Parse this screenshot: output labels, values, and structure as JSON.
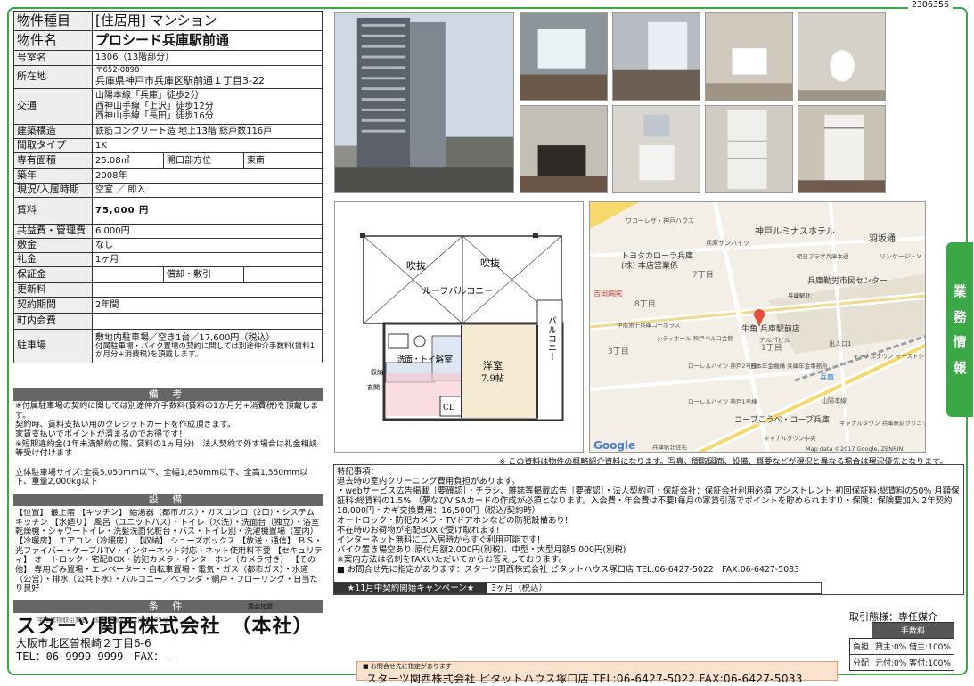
{
  "ref_no": "2306356",
  "property": {
    "rows": [
      {
        "key": "物件種目",
        "value": "[住居用] マンション"
      },
      {
        "key": "物件名",
        "value": "プロシード兵庫駅前通"
      },
      {
        "key": "号室名",
        "value": "1306（13階部分）"
      },
      {
        "key": "所在地",
        "postal": "〒652-0898",
        "value": "兵庫県神戸市兵庫区駅前通１丁目3-22"
      },
      {
        "key": "交通",
        "lines": [
          "山陽本線「兵庫」徒歩2分",
          "西神山手線「上沢」徒歩12分",
          "西神山手線「長田」徒歩16分"
        ]
      },
      {
        "key": "建築構造",
        "value": "鉄筋コンクリート造 地上13階 総戸数116戸"
      },
      {
        "key": "間取タイプ",
        "value": "1K"
      },
      {
        "key": "専有面積",
        "value": "25.08㎡",
        "key2": "開口部方位",
        "value2": "東南"
      },
      {
        "key": "築年",
        "value": "2008年"
      },
      {
        "key": "現況/入居時期",
        "value": "空室 ／ 即入"
      },
      {
        "key": "賃料",
        "value": "75,000 円"
      },
      {
        "key": "共益費・管理費",
        "value": "6,000円"
      },
      {
        "key": "敷金",
        "value": "なし"
      },
      {
        "key": "礼金",
        "value": "1ヶ月"
      },
      {
        "key": "保証金",
        "value": "",
        "key2": "償却・敷引",
        "value2": ""
      },
      {
        "key": "更新料",
        "value": ""
      },
      {
        "key": "契約期間",
        "value": "2年間"
      },
      {
        "key": "町内会費",
        "value": ""
      },
      {
        "key": "駐車場",
        "value": "敷地内駐車場／空き1台／17,600円（税込）",
        "note": "付属駐車場・バイク置場の契約に関しては別途仲介手数料(賃料1か月分+消費税)を頂戴します。"
      }
    ]
  },
  "bikou": {
    "title": "備 考",
    "text": "※付属駐車場の契約に関しては別途仲介手数料(賃料の1か月分+消費税)を頂戴します。\n契約時、賃料支払い用のクレジットカードを作成頂きます。\n家賃支払いでポイントが溜まるのでお得です！\n※短期違約金(1年未満解約の際、賃料の1ヵ月分)　法人契約で外す場合は礼金相談等受け付けます\n\n立体駐車場サイズ:全長5,050mm以下、全幅1,850mm以下、全高1,550mm以下、重量2,000kg以下"
  },
  "setsubi": {
    "title": "設 備",
    "text": "【位置】 最上階 【キッチン】 給湯器（都市ガス）・ガスコンロ（2口）・システムキッチン 【水廻り】 風呂（ユニットバス）・トイレ（水洗）・洗面台（独立）・浴室乾燥機・シャワートイレ・洗髪洗面化粧台・バス・トイレ別・洗濯機置場（室内） 【冷暖房】 エアコン（冷暖房） 【収納】 シューズボックス 【放送・通信】 ＢＳ・光ファイバー・ケーブルTV・インターネット対応・ネット使用料不要 【セキュリティ】 オートロック・宅配BOX・防犯カメラ・インターホン（カメラ付き） 【その他】 専用ごみ置場・エレベーター・自転車置場・電気・ガス（都市ガス）・水道（公営）・排水（公共下水）・バルコニー／ベランダ・網戸・フローリング・日当たり良好"
  },
  "jouken": {
    "title": "条 件"
  },
  "floorplan": {
    "labels": {
      "fukinuke1": "吹抜",
      "fukinuke2": "吹抜",
      "roof_balcony": "ルーフバルコニー",
      "balcony": "バルコニー",
      "washroom": "洗面・トイレ",
      "bath": "浴室",
      "room": "洋室",
      "room_size": "7.9帖",
      "storage": "収納",
      "entrance": "玄関",
      "closet": "CL"
    }
  },
  "map": {
    "labels": [
      "ワコーレザ・神戸ハウス",
      "神戸ルミナスホテル",
      "羽坂通",
      "兵庫サンハイツ",
      "トヨタカローラ兵庫",
      "(株) 本店営業係",
      "朝日プラザ兵庫本通",
      "リンケージ・V",
      "7丁目",
      "兵庫勤労市民センター",
      "吉田病院",
      "8丁目",
      "兵庫駅北",
      "甲南第十兵庫コーポラス",
      "牛角 兵庫駅前店",
      "シティホール 神戸ベルコ会館",
      "アルパビル",
      "3丁目",
      "1丁目",
      "出入口1",
      "ローレルハイツ 神戸2号棟",
      "日本年金機構 兵庫年金事務所",
      "兵庫",
      "キャナルタウン イーストシティハイツ",
      "ローレルハイツ 神戸1号棟",
      "山陽本線",
      "コープこうべ・コープ兵庫",
      "キャナルタウン 兵庫駅前クリニックビル",
      "キャナルタウン中央",
      "兵庫駅北住宅"
    ],
    "google": "Google",
    "attribution": "Map data ©2017 Google, ZENRIN"
  },
  "disclaimer": "※ この資料は物件の概略紹介資料になります。写真、間取図面、設備、概要などが現況と異なる場合は現況優先となります。",
  "tokki": {
    "lines": [
      "特記事項：",
      "退去時の室内クリーニング費用負担があります。",
      "・webサービス広告掲載［要確認］・チラシ、雑誌等掲載広告［要確認］・法人契約可・保証会社：保証会社利用必須 アシストレント 初回保証料:総賃料の50% 月額保証料:総賃料の1.5% （夢なびVISAカードの作成が必須となります。入会費・年会費は不要!毎月の家賃引落でポイントを貯められます!）・保険：保険要加入 2年契約 18,000円・カギ交換費用：16,500円（税込/契約時）",
      "オートロック・防犯カメラ・TVドアホンなどの防犯設備あり!",
      "不在時のお荷物が宅配BOXで受け取れます!",
      "インターネット無料にご入居時からすぐ利用可能です!",
      "バイク置き場空あり:原付月額2,000円(別税)、中型・大型月額5,000円(別税)",
      "※案内方法は名刺をFAXいただいてからお答えしております。",
      "■ お問合せ先に指定があります：スターツ関西株式会社 ピタットハウス塚口店 TEL:06-6427-5022　FAX:06-6427-5033"
    ]
  },
  "campaign": {
    "label": "★11月中契約開始キャンペーン★",
    "value": "3ヶ月（税込）"
  },
  "side_tab": [
    "業",
    "務",
    "情",
    "報"
  ],
  "company": {
    "name": "スターツ関西株式会社　（本社）",
    "address": "大阪市北区曽根崎２丁目6-6",
    "tel": "TEL：06-9999-9999　FAX：--",
    "overlap_text": "宅地建物取引業者　国土交通大臣(1)第9999号",
    "sr": "議会加盟"
  },
  "torihiki": {
    "label": "取引態様：専任媒介",
    "fee_header": "手数料",
    "rows": [
      {
        "k": "負担",
        "v": "貸主:0%  借主:100%"
      },
      {
        "k": "分配",
        "v": "元付:0%  客付:100%"
      }
    ]
  },
  "contact": {
    "caption": "■ お問合せ先に指定があります",
    "text": "スターツ関西株式会社 ピタットハウス塚口店 TEL:06-6427-5022  FAX:06-6427-5033"
  }
}
